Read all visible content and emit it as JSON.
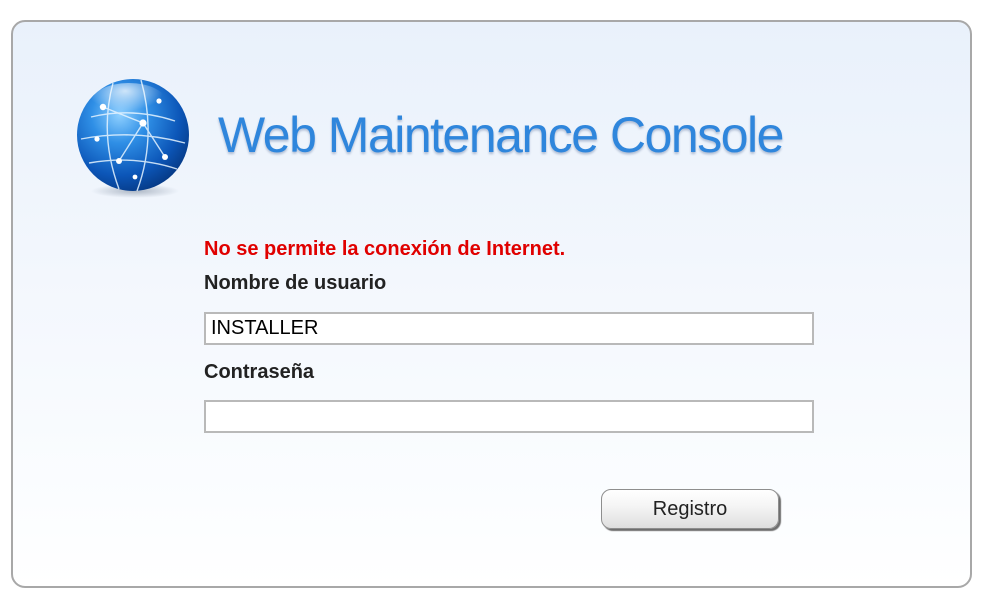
{
  "header": {
    "title": "Web Maintenance Console",
    "logo_icon": "globe-network-icon"
  },
  "login": {
    "error_message": "No se permite la conexión de Internet.",
    "username_label": "Nombre de usuario",
    "username_value": "INSTALLER",
    "password_label": "Contraseña",
    "password_value": "",
    "submit_label": "Registro"
  },
  "colors": {
    "title": "#2f86dc",
    "error": "#e00000",
    "panel_border": "#a8a8a8"
  }
}
